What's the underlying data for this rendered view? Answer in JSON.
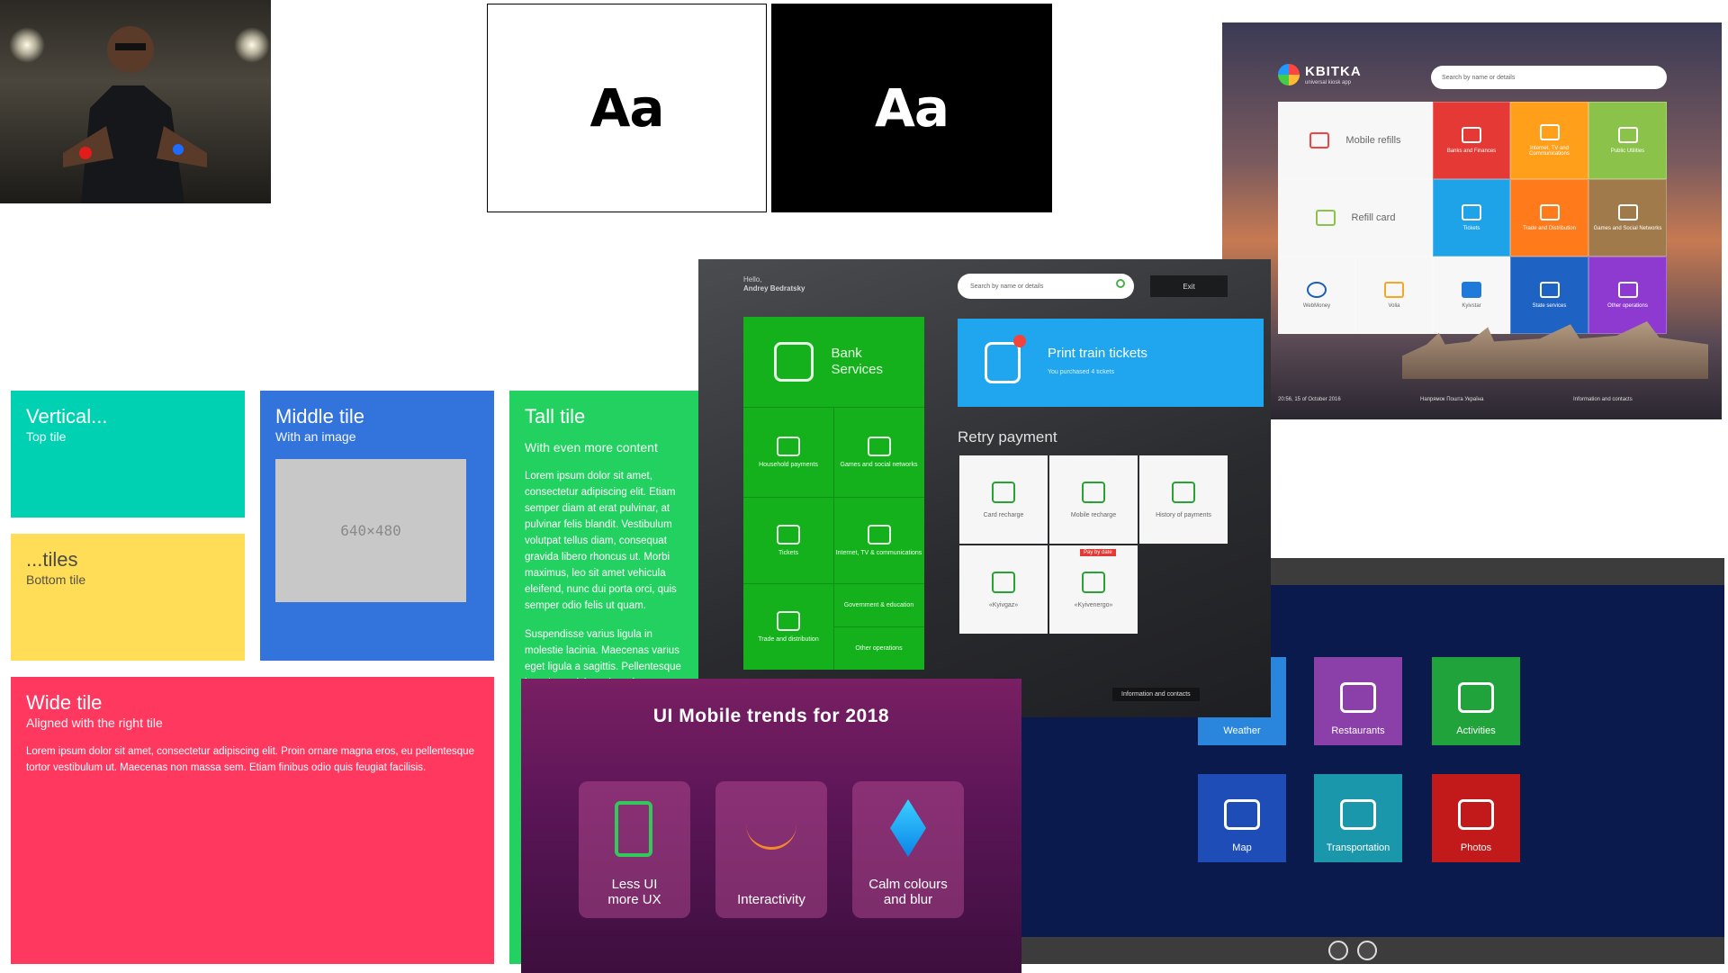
{
  "typography": {
    "white_sample": "Aa",
    "black_sample": "Aa"
  },
  "tiles": {
    "vertical": {
      "title": "Vertical...",
      "subtitle": "Top tile"
    },
    "bottom": {
      "title": "...tiles",
      "subtitle": "Bottom tile"
    },
    "middle": {
      "title": "Middle tile",
      "subtitle": "With an image",
      "image_label": "640×480"
    },
    "tall": {
      "title": "Tall tile",
      "subtitle": "With even more content",
      "para1": "Lorem ipsum dolor sit amet, consectetur adipiscing elit. Etiam semper diam at erat pulvinar, at pulvinar felis blandit. Vestibulum volutpat tellus diam, consequat gravida libero rhoncus ut. Morbi maximus, leo sit amet vehicula eleifend, nunc dui porta orci, quis semper odio felis ut quam.",
      "para2": "Suspendisse varius ligula in molestie lacinia. Maecenas varius eget ligula a sagittis. Pellentesque interdum, nisl nec interdum maximus, augue diam"
    },
    "wide": {
      "title": "Wide tile",
      "subtitle": "Aligned with the right tile",
      "para": "Lorem ipsum dolor sit amet, consectetur adipiscing elit. Proin ornare magna eros, eu pellentesque tortor vestibulum ut. Maecenas non massa sem. Etiam finibus odio quis feugiat facilisis."
    }
  },
  "kiosk": {
    "hello": "Hello,",
    "user": "Andrey Bedratsky",
    "search_placeholder": "Search by name or details",
    "exit": "Exit",
    "bank": "Bank Services",
    "green_cells": [
      "Household payments",
      "Games and social networks",
      "Tickets",
      "Internet, TV & communications",
      "Government & education",
      "Trade and distribution",
      "Other operations"
    ],
    "print_title": "Print train tickets",
    "print_sub": "You purchased 4 tickets",
    "retry": "Retry payment",
    "retry_cells": [
      "Card recharge",
      "Mobile recharge",
      "History of payments",
      "«Kyivgaz»",
      "«Kyivenergo»"
    ],
    "tag": "Pay by date",
    "info": "Information and contacts"
  },
  "kbitka": {
    "brand": "KBITKA",
    "tagline": "universal kiosk app",
    "search_placeholder": "Search by name or details",
    "cells": [
      "Mobile refills",
      "Banks and Finances",
      "Internet, TV and Communications",
      "Public Utilities",
      "Refill card",
      "Tickets",
      "Trade and Distribution",
      "Games and Social Networks",
      "WebMoney",
      "Volia",
      "Kyivstar",
      "State services",
      "Other operations"
    ],
    "date": "20:56, 15 of October 2016",
    "contacts": "Information and contacts",
    "center_foot": "Напрямок Пошта Україна"
  },
  "metro": {
    "tiles": [
      "Weather",
      "Restaurants",
      "Activities",
      "Map",
      "Transportation",
      "Photos"
    ]
  },
  "trends": {
    "title": "UI Mobile trends for 2018",
    "cards": [
      "Less UI more UX",
      "Interactivity",
      "Calm colours and blur"
    ]
  }
}
